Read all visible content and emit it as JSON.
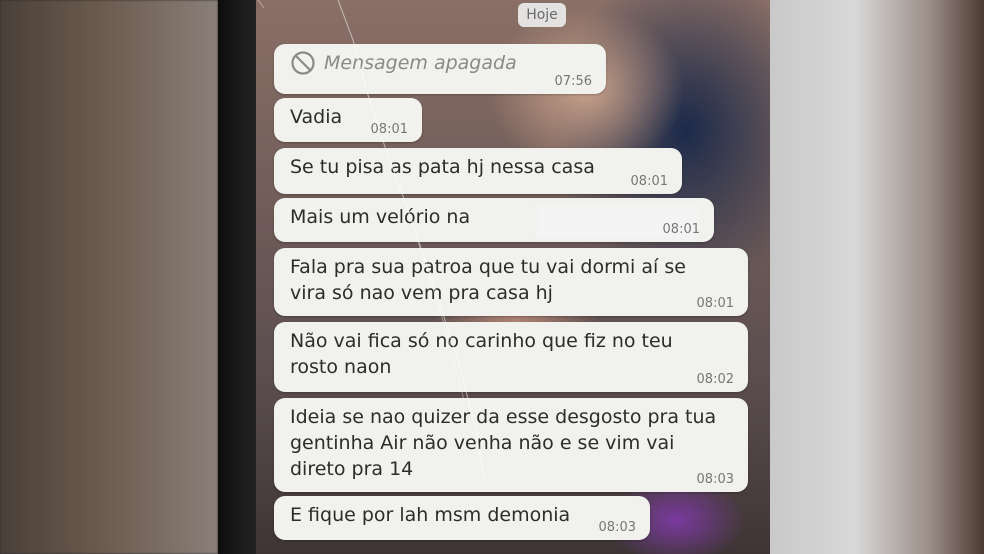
{
  "chat": {
    "date_label": "Hoje",
    "deleted": {
      "text": "Mensagem apagada",
      "time": "07:56"
    },
    "messages": [
      {
        "text": "Vadia",
        "time": "08:01"
      },
      {
        "text": "Se tu pisa as pata hj nessa casa",
        "time": "08:01"
      },
      {
        "text": "Mais um velório na",
        "time": "08:01"
      },
      {
        "text": "Fala pra sua patroa que tu vai dormi aí se\nvira só nao vem pra casa hj",
        "time": "08:01"
      },
      {
        "text": "Não vai fica só no carinho que fiz no teu\nrosto naon",
        "time": "08:02"
      },
      {
        "text": "Ideia se nao quizer da esse desgosto pra tua\ngentinha Air não venha não e se vim vai\ndireto pra 14",
        "time": "08:03"
      },
      {
        "text": "E fique por lah msm demonia",
        "time": "08:03"
      }
    ]
  },
  "colors": {
    "bubble": "#f1f1ee",
    "time": "#777777",
    "deleted_text": "#8a8a8a"
  },
  "icons": {
    "deleted": "blocked-circle-icon"
  }
}
